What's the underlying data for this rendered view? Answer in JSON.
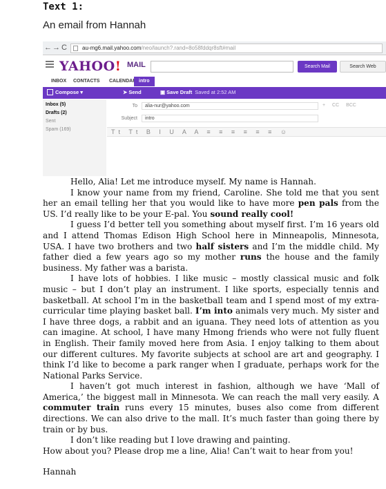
{
  "heading": "Text 1:",
  "subheading": "An email from Hannah",
  "browser": {
    "nav_back": "←",
    "nav_forward": "→",
    "nav_reload": "C",
    "url_main": "au-mg6.mail.yahoo.com",
    "url_rest": "/neo/launch?.rand=8o58fddqr8sft#mail"
  },
  "yahoo": {
    "logo": "YAHOO!",
    "mail": "MAIL",
    "search_mail": "Search Mail",
    "search_web": "Search Web",
    "tabs": [
      "INBOX",
      "CONTACTS",
      "CALENDAR",
      "intro"
    ],
    "compose": "Compose",
    "send": "Send",
    "save_draft": "Save Draft",
    "saved_at": "Saved at 2:52 AM",
    "folders": [
      "Inbox (5)",
      "Drafts (2)",
      "Sent",
      "Spam (169)"
    ],
    "to_label": "To",
    "to_value": "alia-nur@yahoo.com",
    "to_extra": "+ CC BCC",
    "subject_label": "Subject",
    "subject_value": "intro",
    "format_icons": "Tt Tt B I U A A ≡ ≡ ≡ ≡ ≡ ≡ ☺"
  },
  "letter": {
    "p1": "Hello, Alia! Let me introduce myself. My name is Hannah.",
    "p2a": "I know your name from my friend, Caroline. She told me that you sent her an email telling her that you would like to have more ",
    "p2b": "pen pals",
    "p2c": " from the US. I’d really like to be your E-pal. You ",
    "p2d": "sound really cool!",
    "p3a": "I guess I’d better tell you something about myself first. I’m 16 years old and I attend Thomas Edison High School here in Minneapolis, Minnesota, USA. I have two brothers and two ",
    "p3b": "half sisters",
    "p3c": " and I’m the middle child. My father died a few years ago so my mother ",
    "p3d": "runs",
    "p3e": " the house and the family business. My father was a barista.",
    "p4a": "I have lots of hobbies. I like music – mostly classical music and folk music – but I don’t play an instrument. I like sports, especially tennis and basketball. At school I’m in the basketball team and I spend most of my extra-curricular time playing basket ball. ",
    "p4b": "I’m into",
    "p4c": " animals very much. My sister and I have three dogs, a rabbit and an iguana. They need lots of attention as you can imagine. At school, I have many Hmong friends who were not fully fluent in English. Their family moved here from Asia. I enjoy talking to them about our different cultures. My favorite subjects at school are art and geography. I think I’d like to become a park ranger when I graduate, perhaps work for the National Parks Service.",
    "p5a": "I haven’t got much interest in fashion, although we have ‘Mall of America,’ the biggest mall in Minnesota. We can reach the mall very easily. A ",
    "p5b": "commuter train",
    "p5c": " runs every 15 minutes, buses also come from different directions. We can also drive to the mall. It’s much faster than going there by train or by bus.",
    "p6": "I don’t like reading but I love drawing and painting.",
    "p7": "How about you? Please drop me a line, Alia! Can’t wait to hear from you!",
    "signature": "Hannah"
  }
}
